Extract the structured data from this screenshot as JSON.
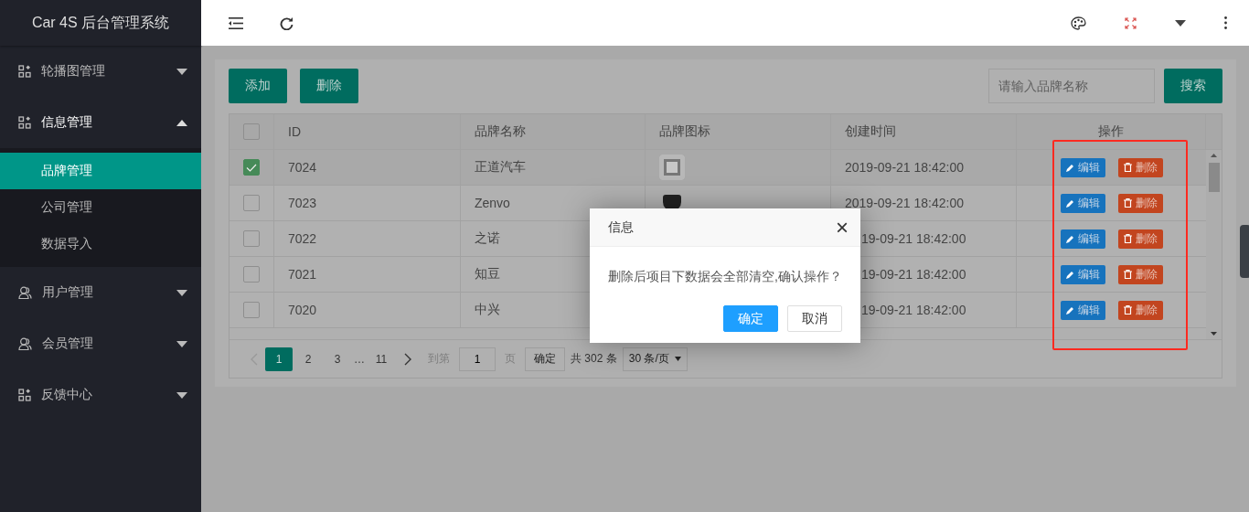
{
  "app_title": "Car 4S 后台管理系统",
  "sidebar": {
    "items": [
      {
        "label": "轮播图管理",
        "kind": "grid",
        "expanded": false
      },
      {
        "label": "信息管理",
        "kind": "grid",
        "expanded": true,
        "children": [
          {
            "label": "品牌管理",
            "selected": true
          },
          {
            "label": "公司管理",
            "selected": false
          },
          {
            "label": "数据导入",
            "selected": false
          }
        ]
      },
      {
        "label": "用户管理",
        "kind": "user",
        "expanded": false
      },
      {
        "label": "会员管理",
        "kind": "user",
        "expanded": false
      },
      {
        "label": "反馈中心",
        "kind": "grid",
        "expanded": false
      }
    ]
  },
  "toolbar": {
    "buttons": [
      "添加",
      "删除"
    ],
    "search": {
      "placeholder": "请输入品牌名称"
    },
    "search_button": "搜索"
  },
  "table": {
    "columns": [
      "ID",
      "品牌名称",
      "品牌图标",
      "创建时间",
      "操作"
    ],
    "header_checked": false,
    "rows": [
      {
        "selected": true,
        "id": "7024",
        "name": "正道汽车",
        "logo": {
          "kind": "emblem"
        },
        "created": "2019-09-21 18:42:00",
        "edit": "编辑",
        "delete": "删除"
      },
      {
        "selected": false,
        "id": "7023",
        "name": "Zenvo",
        "logo": {
          "kind": "shield"
        },
        "created": "2019-09-21 18:42:00",
        "edit": "编辑",
        "delete": "删除"
      },
      {
        "selected": false,
        "id": "7022",
        "name": "之诺",
        "created": "19-09-21 18:42:00",
        "edit": "编辑",
        "delete": "删除"
      },
      {
        "selected": false,
        "id": "7021",
        "name": "知豆",
        "created": "19-09-21 18:42:00",
        "edit": "编辑",
        "delete": "删除"
      },
      {
        "selected": false,
        "id": "7020",
        "name": "中兴",
        "created": "19-09-21 18:42:00",
        "edit": "编辑",
        "delete": "删除"
      }
    ]
  },
  "pagination": {
    "pages": [
      {
        "label": "1",
        "selected": true
      },
      {
        "label": "2",
        "selected": false
      },
      {
        "label": "3",
        "selected": false
      },
      {
        "label": "…",
        "kind": "ellipsis"
      },
      {
        "label": "11",
        "selected": false
      }
    ],
    "goto_label": "到第",
    "goto_value": "1",
    "page_unit": "页",
    "confirm": "确定",
    "total": "共 302 条",
    "page_size": "30 条/页"
  },
  "dialog": {
    "title": "信息",
    "close": "×",
    "message": "删除后项目下数据会全部清空,确认操作？",
    "buttons": [
      {
        "label": "确定",
        "kind": "primary"
      },
      {
        "label": "取消",
        "kind": "secondary"
      }
    ]
  }
}
